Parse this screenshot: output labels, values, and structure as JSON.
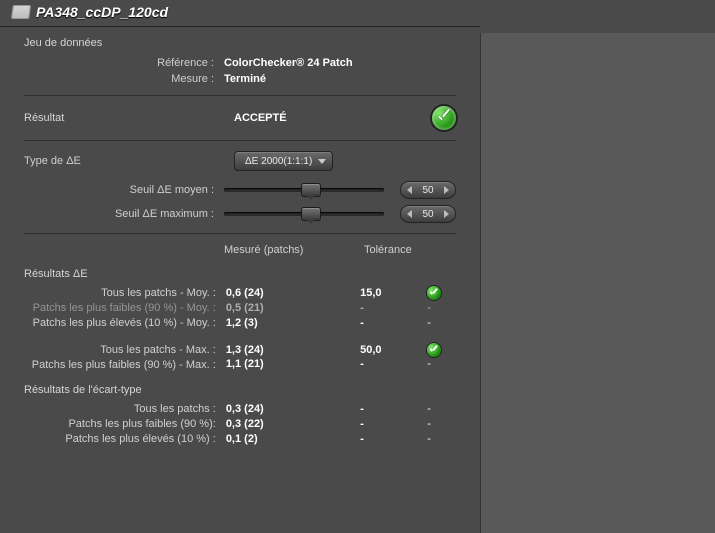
{
  "title": "PA348_ccDP_120cd",
  "dataset": {
    "label": "Jeu de données",
    "reference_label": "Référence :",
    "reference_value": "ColorChecker® 24 Patch",
    "measure_label": "Mesure :",
    "measure_value": "Terminé"
  },
  "result": {
    "label": "Résultat",
    "value": "ACCEPTÉ"
  },
  "delta_e_type": {
    "label": "Type de ΔE",
    "selected": "ΔE 2000(1:1:1)"
  },
  "thresholds": {
    "avg_label": "Seuil ΔE moyen :",
    "avg_value": "50",
    "max_label": "Seuil ΔE maximum :",
    "max_value": "50"
  },
  "columns": {
    "measured": "Mesuré (patchs)",
    "tolerance": "Tolérance"
  },
  "delta_e_results": {
    "heading": "Résultats ΔE",
    "rows": [
      {
        "label": "Tous les patchs - Moy. :",
        "measured": "0,6  (24)",
        "tolerance": "15,0",
        "ok": true
      },
      {
        "label": "Patchs les plus faibles (90 %) - Moy. :",
        "measured": "0,5  (21)",
        "tolerance": "-",
        "ok": "-",
        "faded": true
      },
      {
        "label": "Patchs les plus élevés (10 %) - Moy. :",
        "measured": "1,2  (3)",
        "tolerance": "-",
        "ok": "-"
      },
      {
        "spacer": true
      },
      {
        "label": "Tous les patchs - Max. :",
        "measured": "1,3  (24)",
        "tolerance": "50,0",
        "ok": true
      },
      {
        "label": "Patchs les plus faibles (90 %) - Max. :",
        "measured": "1,1  (21)",
        "tolerance": "-",
        "ok": "-"
      }
    ]
  },
  "stddev_results": {
    "heading": "Résultats de l'écart-type",
    "rows": [
      {
        "label": "Tous les patchs :",
        "measured": "0,3  (24)",
        "tolerance": "-",
        "ok": "-"
      },
      {
        "label": "Patchs les plus faibles (90 %):",
        "measured": "0,3  (22)",
        "tolerance": "-",
        "ok": "-"
      },
      {
        "label": "Patchs les plus élevés (10 %) :",
        "measured": "0,1 (2)",
        "tolerance": "-",
        "ok": "-"
      }
    ]
  }
}
